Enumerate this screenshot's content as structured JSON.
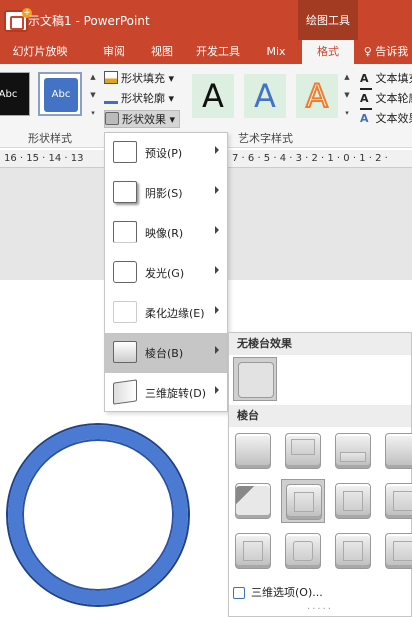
{
  "titlebar": {
    "title": "示文稿1 - PowerPoint",
    "tool_group": "绘图工具"
  },
  "tabs": [
    {
      "label": "幻灯片放映"
    },
    {
      "label": "审阅"
    },
    {
      "label": "视图"
    },
    {
      "label": "开发工具"
    },
    {
      "label": "Mix"
    },
    {
      "label": "格式",
      "active": true
    },
    {
      "label": "♀ 告诉我"
    }
  ],
  "ribbon": {
    "shape_style_thumbs": [
      "Abc",
      "Abc"
    ],
    "shape_commands": [
      {
        "label": "形状填充 ▾",
        "icon": "paint-bucket-icon"
      },
      {
        "label": "形状轮廓 ▾",
        "icon": "pencil-outline-icon"
      },
      {
        "label": "形状效果 ▾",
        "icon": "shape-effects-icon"
      }
    ],
    "shape_styles_label": "形状样式",
    "wordart_samples": [
      "A",
      "A",
      "A"
    ],
    "wordart_label": "艺术字样式",
    "text_commands": [
      {
        "glyph": "A",
        "label": "文本填充"
      },
      {
        "glyph": "A",
        "label": "文本轮廓"
      },
      {
        "glyph": "A",
        "label": "文本效果"
      }
    ]
  },
  "ruler": {
    "left_text": "16 · 15 · 14 · 13",
    "right_text": "7 · 6 · 5 · 4 · 3 · 2 · 1 · 0 · 1 · 2 ·"
  },
  "effects_menu": {
    "items": [
      {
        "label": "预设(P)"
      },
      {
        "label": "阴影(S)"
      },
      {
        "label": "映像(R)"
      },
      {
        "label": "发光(G)"
      },
      {
        "label": "柔化边缘(E)"
      },
      {
        "label": "棱台(B)",
        "highlighted": true
      },
      {
        "label": "三维旋转(D)"
      }
    ]
  },
  "bevel_submenu": {
    "no_bevel_header": "无棱台效果",
    "bevel_header": "棱台",
    "options_label": "三维选项(O)...",
    "dots": "....."
  },
  "colors": {
    "accent": "#c9462c",
    "ring": "#4a7ad2"
  }
}
